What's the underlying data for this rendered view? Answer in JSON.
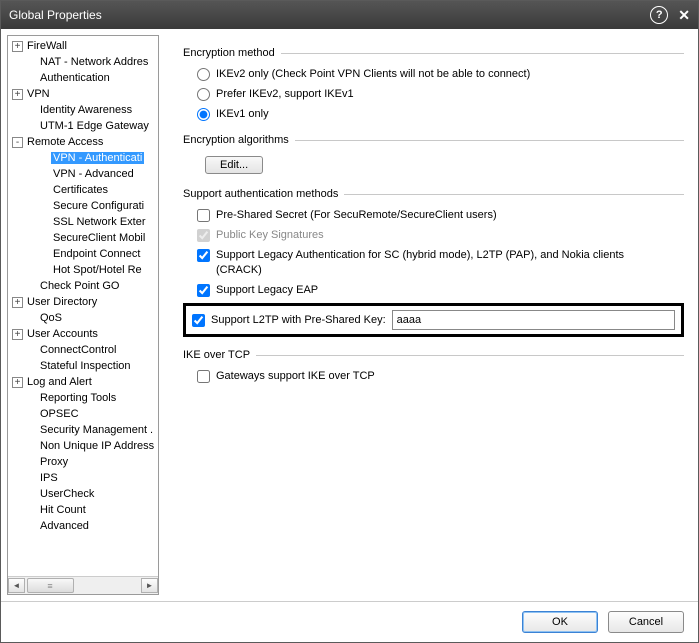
{
  "window": {
    "title": "Global Properties"
  },
  "tree": {
    "nodes": [
      {
        "depth": 0,
        "exp": "+",
        "label": "FireWall"
      },
      {
        "depth": 1,
        "exp": "",
        "label": "NAT - Network Addres"
      },
      {
        "depth": 1,
        "exp": "",
        "label": "Authentication"
      },
      {
        "depth": 0,
        "exp": "+",
        "label": "VPN"
      },
      {
        "depth": 1,
        "exp": "",
        "label": "Identity Awareness"
      },
      {
        "depth": 1,
        "exp": "",
        "label": "UTM-1 Edge Gateway"
      },
      {
        "depth": 0,
        "exp": "-",
        "label": "Remote Access"
      },
      {
        "depth": 2,
        "exp": "",
        "label": "VPN - Authenticati",
        "selected": true
      },
      {
        "depth": 2,
        "exp": "",
        "label": "VPN - Advanced"
      },
      {
        "depth": 2,
        "exp": "",
        "label": "Certificates"
      },
      {
        "depth": 2,
        "exp": "",
        "label": "Secure Configurati"
      },
      {
        "depth": 2,
        "exp": "",
        "label": "SSL Network Exter"
      },
      {
        "depth": 2,
        "exp": "",
        "label": "SecureClient Mobil"
      },
      {
        "depth": 2,
        "exp": "",
        "label": "Endpoint Connect"
      },
      {
        "depth": 2,
        "exp": "",
        "label": "Hot Spot/Hotel Re"
      },
      {
        "depth": 1,
        "exp": "",
        "label": "Check Point GO"
      },
      {
        "depth": 0,
        "exp": "+",
        "label": "User Directory"
      },
      {
        "depth": 1,
        "exp": "",
        "label": "QoS"
      },
      {
        "depth": 0,
        "exp": "+",
        "label": "User Accounts"
      },
      {
        "depth": 1,
        "exp": "",
        "label": "ConnectControl"
      },
      {
        "depth": 1,
        "exp": "",
        "label": "Stateful Inspection"
      },
      {
        "depth": 0,
        "exp": "+",
        "label": "Log and Alert"
      },
      {
        "depth": 1,
        "exp": "",
        "label": "Reporting Tools"
      },
      {
        "depth": 1,
        "exp": "",
        "label": "OPSEC"
      },
      {
        "depth": 1,
        "exp": "",
        "label": "Security Management ."
      },
      {
        "depth": 1,
        "exp": "",
        "label": "Non Unique IP Address"
      },
      {
        "depth": 1,
        "exp": "",
        "label": "Proxy"
      },
      {
        "depth": 1,
        "exp": "",
        "label": "IPS"
      },
      {
        "depth": 1,
        "exp": "",
        "label": "UserCheck"
      },
      {
        "depth": 1,
        "exp": "",
        "label": "Hit Count"
      },
      {
        "depth": 1,
        "exp": "",
        "label": "Advanced"
      }
    ]
  },
  "panel": {
    "encryption_method": {
      "title": "Encryption method",
      "options": {
        "ikev2_only": "IKEv2 only (Check Point VPN Clients will not be able to connect)",
        "prefer_ikev2": "Prefer IKEv2, support IKEv1",
        "ikev1_only": "IKEv1 only"
      },
      "selected": "ikev1_only"
    },
    "encryption_algorithms": {
      "title": "Encryption algorithms",
      "edit_label": "Edit..."
    },
    "auth_methods": {
      "title": "Support authentication methods",
      "preshared": {
        "label": "Pre-Shared Secret (For SecuRemote/SecureClient users)",
        "checked": false,
        "enabled": true
      },
      "pubkey": {
        "label": "Public Key Signatures",
        "checked": true,
        "enabled": false
      },
      "legacy_sc": {
        "label": "Support Legacy Authentication for SC (hybrid mode), L2TP (PAP), and Nokia clients (CRACK)",
        "checked": true,
        "enabled": true
      },
      "legacy_eap": {
        "label": "Support Legacy EAP",
        "checked": true,
        "enabled": true
      },
      "l2tp_psk": {
        "label": "Support L2TP with Pre-Shared Key:",
        "checked": true,
        "enabled": true,
        "value": "aaaa"
      }
    },
    "ike_over_tcp": {
      "title": "IKE over TCP",
      "gw_support": {
        "label": "Gateways support IKE over TCP",
        "checked": false
      }
    }
  },
  "footer": {
    "ok": "OK",
    "cancel": "Cancel"
  }
}
